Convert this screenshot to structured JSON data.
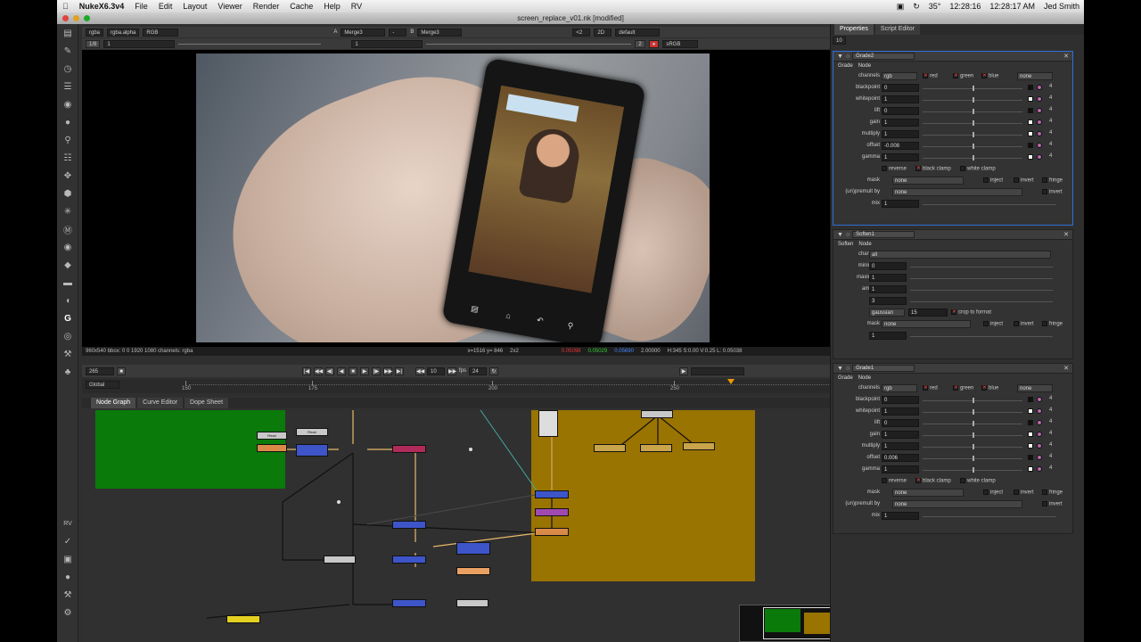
{
  "menubar": {
    "app": "NukeX6.3v4",
    "items": [
      "File",
      "Edit",
      "Layout",
      "Viewer",
      "Render",
      "Cache",
      "Help",
      "RV"
    ],
    "temp": "35°",
    "clock1": "12:28:16",
    "clock2": "12:28:17 AM",
    "user": "Jed Smith"
  },
  "title": "screen_replace_v01.nk [modified]",
  "viewer": {
    "chan1": "rgba",
    "chan2": "rgba.alpha",
    "chan3": "RGB",
    "a_label": "A",
    "a_input": "Merge3",
    "b_label": "B",
    "b_input": "Merge3",
    "zoom": "2D",
    "lut": "default",
    "frame_ratio": "1/8",
    "frame_a": "1",
    "gain_btn": "2",
    "colorspace": "sRGB",
    "info": "960x540 bbox: 0 0 1920 1080 channels: rgba",
    "coords": "x=1516 y= 846",
    "tile": "2x2",
    "rgba_vals": [
      "0.05098",
      "0.05029",
      "0.05690",
      "2.00000"
    ],
    "hsv": "H:345 S:0.00 V:0.25  L: 0.05038"
  },
  "timeline": {
    "frame": "265",
    "mode": "Global",
    "fps_label": "fps",
    "fps": "24",
    "step": "10",
    "ticks": [
      "150",
      "200",
      "250",
      "300",
      "306"
    ]
  },
  "nodegraph": {
    "tabs": [
      "Node Graph",
      "Curve Editor",
      "Dope Sheet"
    ]
  },
  "props": {
    "tabs": [
      "Properties",
      "Script Editor"
    ],
    "max_panels": "10",
    "grade2": {
      "name": "Grade2",
      "subtabs": [
        "Grade",
        "Node"
      ],
      "channels": "rgb",
      "ch_r": "red",
      "ch_g": "green",
      "ch_b": "blue",
      "ch_a": "none",
      "params": [
        {
          "label": "blackpoint",
          "val": "0",
          "sw": "#111"
        },
        {
          "label": "whitepoint",
          "val": "1",
          "sw": "#fff"
        },
        {
          "label": "lift",
          "val": "0",
          "sw": "#111"
        },
        {
          "label": "gain",
          "val": "1",
          "sw": "#fff"
        },
        {
          "label": "multiply",
          "val": "1",
          "sw": "#fff"
        },
        {
          "label": "offset",
          "val": "-0.008",
          "sw": "#111"
        },
        {
          "label": "gamma",
          "val": "1",
          "sw": "#fff"
        }
      ],
      "reverse": "reverse",
      "black_clamp": "black clamp",
      "white_clamp": "white clamp",
      "mask": "mask",
      "mask_val": "none",
      "inject": "inject",
      "invert": "invert",
      "fringe": "fringe",
      "unpremult": "(un)premult by",
      "unpremult_val": "none",
      "mix": "mix",
      "mix_val": "1",
      "num4": "4"
    },
    "soften1": {
      "name": "Soften1",
      "subtabs": [
        "Soften",
        "Node"
      ],
      "channels": "all",
      "params": [
        {
          "label": "minimum",
          "val": "0"
        },
        {
          "label": "maximum",
          "val": "1"
        },
        {
          "label": "amount",
          "val": "1"
        },
        {
          "label": "size",
          "val": "3"
        }
      ],
      "filter": "filter",
      "filter_val": "gaussian",
      "filter_num": "15",
      "crop": "crop to format",
      "mask": "mask",
      "mask_val": "none",
      "inject": "inject",
      "invert": "invert",
      "fringe": "fringe",
      "mix": "mix",
      "mix_val": "1"
    },
    "grade1": {
      "name": "Grade1",
      "subtabs": [
        "Grade",
        "Node"
      ],
      "channels": "rgb",
      "ch_r": "red",
      "ch_g": "green",
      "ch_b": "blue",
      "ch_a": "none",
      "params": [
        {
          "label": "blackpoint",
          "val": "0",
          "sw": "#111"
        },
        {
          "label": "whitepoint",
          "val": "1",
          "sw": "#fff"
        },
        {
          "label": "lift",
          "val": "0",
          "sw": "#111"
        },
        {
          "label": "gain",
          "val": "1",
          "sw": "#fff"
        },
        {
          "label": "multiply",
          "val": "1",
          "sw": "#fff"
        },
        {
          "label": "offset",
          "val": "0.006",
          "sw": "#111"
        },
        {
          "label": "gamma",
          "val": "1",
          "sw": "#fff"
        }
      ],
      "reverse": "reverse",
      "black_clamp": "black clamp",
      "white_clamp": "white clamp",
      "mask": "mask",
      "mask_val": "none",
      "inject": "inject",
      "invert": "invert",
      "fringe": "fringe",
      "unpremult": "(un)premult by",
      "unpremult_val": "none",
      "mix": "mix",
      "mix_val": "1",
      "num4": "4"
    }
  },
  "colors": {
    "backdrop_green": "#0a7a0a",
    "backdrop_orange": "#9a7400",
    "accent_blue": "#2f6fd8"
  }
}
